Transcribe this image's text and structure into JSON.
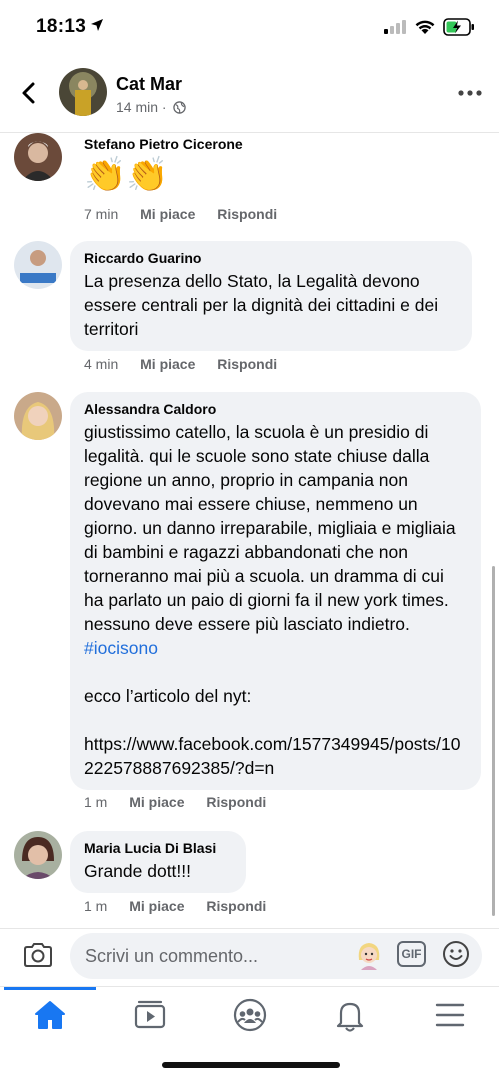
{
  "status_bar": {
    "time": "18:13"
  },
  "header": {
    "name": "Cat Mar",
    "meta": "14 min ·"
  },
  "comments": [
    {
      "name": "Stefano Pietro Cicerone",
      "text": "👏👏",
      "time": "7 min",
      "like": "Mi piace",
      "reply": "Rispondi"
    },
    {
      "name": "Riccardo Guarino",
      "text": "La presenza dello Stato, la Legalità devono essere centrali per la dignità dei cittadini e dei territori",
      "time": "4 min",
      "like": "Mi piace",
      "reply": "Rispondi"
    },
    {
      "name": "Alessandra Caldoro",
      "text": "giustissimo catello, la scuola è un presidio di legalità. qui le scuole sono state chiuse dalla regione un anno, proprio in campania non dovevano mai essere chiuse, nemmeno un giorno. un danno irreparabile, migliaia e migliaia di bambini e ragazzi abbandonati che non torneranno mai più a scuola. un dramma di cui ha parlato un paio di giorni fa il new york times. nessuno deve essere più lasciato indietro. ",
      "hashtag": "#iocisono",
      "text2": "ecco l’articolo del nyt:",
      "link": "https://www.facebook.com/1577349945/posts/10222578887692385/?d=n",
      "time": "1 m",
      "like": "Mi piace",
      "reply": "Rispondi"
    },
    {
      "name": "Maria Lucia Di Blasi",
      "text": "Grande dott!!!",
      "time": "1 m",
      "like": "Mi piace",
      "reply": "Rispondi"
    }
  ],
  "composer": {
    "placeholder": "Scrivi un commento...",
    "gif_label": "GIF"
  },
  "icons": {
    "back": "back-arrow-icon",
    "more": "more-dots-icon",
    "camera": "camera-icon",
    "gif": "gif-icon",
    "emoji": "emoji-icon",
    "home": "home-icon",
    "video": "video-icon",
    "groups": "groups-icon",
    "notifications": "bell-icon",
    "menu": "menu-icon"
  },
  "colors": {
    "accent": "#1877f2",
    "link": "#216fdb",
    "bubble": "#f0f2f5",
    "meta": "#65676b"
  }
}
